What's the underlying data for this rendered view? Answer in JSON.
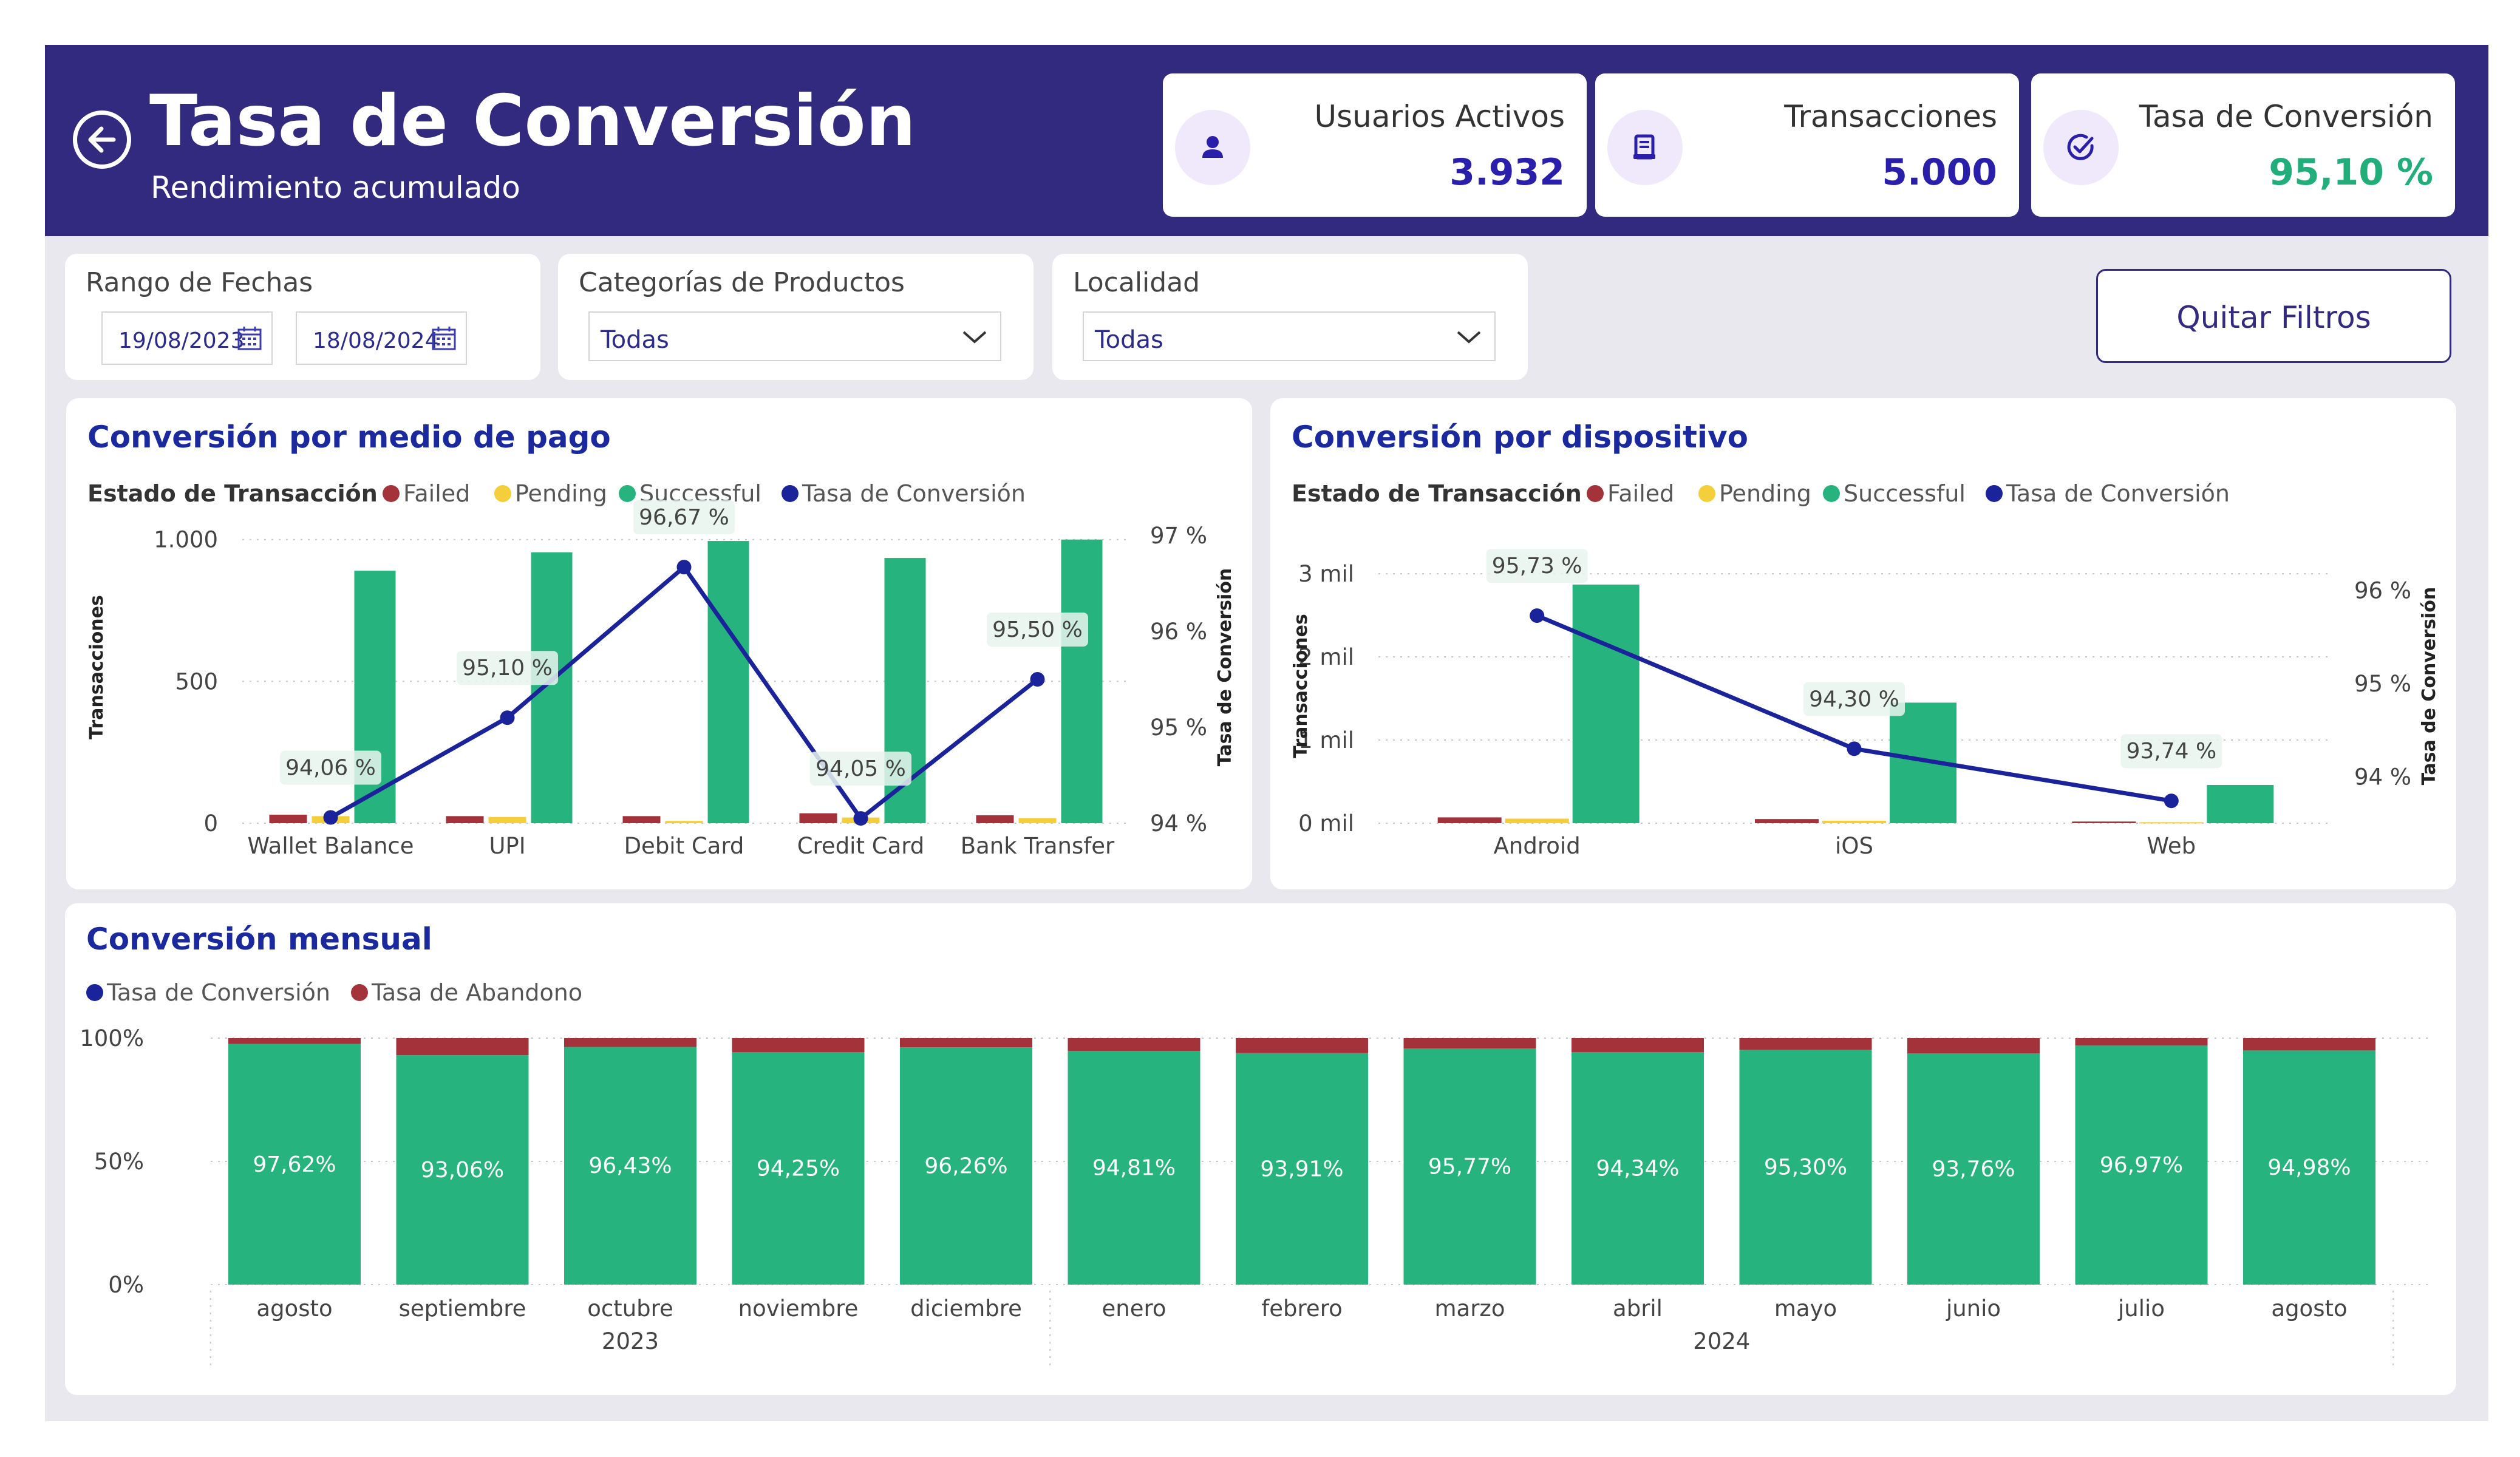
{
  "header": {
    "title": "Tasa de Conversión",
    "subtitle": "Rendimiento acumulado"
  },
  "kpis": [
    {
      "label": "Usuarios Activos",
      "value": "3.932",
      "icon": "user-icon",
      "color": "#2a1faa"
    },
    {
      "label": "Transacciones",
      "value": "5.000",
      "icon": "receipt-icon",
      "color": "#2a1faa"
    },
    {
      "label": "Tasa de Conversión",
      "value": "95,10 %",
      "icon": "check-circle-icon",
      "color": "#22ae7a"
    }
  ],
  "filters": {
    "date_range": {
      "title": "Rango de Fechas",
      "start": "19/08/2023",
      "end": "18/08/2024"
    },
    "category": {
      "title": "Categorías de Productos",
      "value": "Todas"
    },
    "location": {
      "title": "Localidad",
      "value": "Todas"
    },
    "clear_label": "Quitar Filtros"
  },
  "colors": {
    "failed": "#a3323a",
    "pending": "#f5cf3b",
    "successful": "#27b37e",
    "conversion_line": "#1b239a",
    "abandon": "#a3323a",
    "header": "#322a7e"
  },
  "chart_data": [
    {
      "type": "bar",
      "title": "Conversión por medio de pago",
      "legend_title": "Estado de Transacción",
      "legend": [
        "Failed",
        "Pending",
        "Successful",
        "Tasa de Conversión"
      ],
      "categories": [
        "Wallet Balance",
        "UPI",
        "Debit Card",
        "Credit Card",
        "Bank Transfer"
      ],
      "ylabel": "Transacciones",
      "y2label": "Tasa de Conversión",
      "ylim": [
        0,
        1100
      ],
      "y2lim": [
        94,
        97
      ],
      "yticks": [
        0,
        500,
        1000
      ],
      "ytick_labels": [
        "0",
        "500",
        "1.000"
      ],
      "y2ticks": [
        94,
        95,
        96,
        97
      ],
      "y2tick_labels": [
        "94 %",
        "95 %",
        "96 %",
        "97 %"
      ],
      "series": [
        {
          "name": "Failed",
          "values": [
            30,
            25,
            25,
            35,
            28
          ]
        },
        {
          "name": "Pending",
          "values": [
            25,
            22,
            8,
            20,
            18
          ]
        },
        {
          "name": "Successful",
          "values": [
            890,
            955,
            995,
            935,
            1000
          ]
        },
        {
          "name": "Tasa de Conversión",
          "values": [
            94.06,
            95.1,
            96.67,
            94.05,
            95.5
          ],
          "labels": [
            "94,06 %",
            "95,10 %",
            "96,67 %",
            "94,05 %",
            "95,50 %"
          ]
        }
      ]
    },
    {
      "type": "bar",
      "title": "Conversión por dispositivo",
      "legend_title": "Estado de Transacción",
      "legend": [
        "Failed",
        "Pending",
        "Successful",
        "Tasa de Conversión"
      ],
      "categories": [
        "Android",
        "iOS",
        "Web"
      ],
      "ylabel": "Transacciones",
      "y2label": "Tasa de Conversión",
      "ylim": [
        0,
        3300
      ],
      "y2lim": [
        93.5,
        96.5
      ],
      "yticks": [
        0,
        1000,
        2000,
        3000
      ],
      "ytick_labels": [
        "0 mil",
        "1 mil",
        "2 mil",
        "3 mil"
      ],
      "y2ticks": [
        94,
        95,
        96
      ],
      "y2tick_labels": [
        "94 %",
        "95 %",
        "96 %"
      ],
      "series": [
        {
          "name": "Failed",
          "values": [
            70,
            50,
            20
          ]
        },
        {
          "name": "Pending",
          "values": [
            55,
            30,
            12
          ]
        },
        {
          "name": "Successful",
          "values": [
            2870,
            1450,
            460
          ]
        },
        {
          "name": "Tasa de Conversión",
          "values": [
            95.73,
            94.3,
            93.74
          ],
          "labels": [
            "95,73 %",
            "94,30 %",
            "93,74 %"
          ]
        }
      ]
    },
    {
      "type": "bar",
      "title": "Conversión mensual",
      "legend": [
        "Tasa de Conversión",
        "Tasa de Abandono"
      ],
      "categories": [
        "agosto",
        "septiembre",
        "octubre",
        "noviembre",
        "diciembre",
        "enero",
        "febrero",
        "marzo",
        "abril",
        "mayo",
        "junio",
        "julio",
        "agosto"
      ],
      "year_groups": [
        {
          "label": "2023",
          "count": 5
        },
        {
          "label": "2024",
          "count": 8
        }
      ],
      "ylim": [
        0,
        100
      ],
      "yticks": [
        0,
        50,
        100
      ],
      "ytick_labels": [
        "0%",
        "50%",
        "100%"
      ],
      "stacked": true,
      "series": [
        {
          "name": "Tasa de Conversión",
          "values": [
            97.62,
            93.06,
            96.43,
            94.25,
            96.26,
            94.81,
            93.91,
            95.77,
            94.34,
            95.3,
            93.76,
            96.97,
            94.98
          ],
          "labels": [
            "97,62%",
            "93,06%",
            "96,43%",
            "94,25%",
            "96,26%",
            "94,81%",
            "93,91%",
            "95,77%",
            "94,34%",
            "95,30%",
            "93,76%",
            "96,97%",
            "94,98%"
          ]
        },
        {
          "name": "Tasa de Abandono",
          "values": [
            2.38,
            6.94,
            3.57,
            5.75,
            3.74,
            5.19,
            6.09,
            4.23,
            5.66,
            4.7,
            6.24,
            3.03,
            5.02
          ]
        }
      ]
    }
  ]
}
